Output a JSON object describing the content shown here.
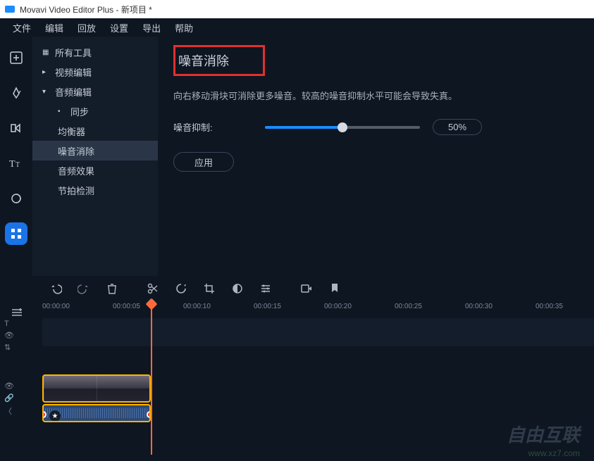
{
  "title": "Movavi Video Editor Plus - 新项目 *",
  "menu": [
    "文件",
    "编辑",
    "回放",
    "设置",
    "导出",
    "帮助"
  ],
  "sidebar": {
    "allTools": "所有工具",
    "videoEdit": "视频编辑",
    "audioEdit": "音频编辑",
    "sync": "同步",
    "equalizer": "均衡器",
    "noiseRemoval": "噪音消除",
    "audioFx": "音频效果",
    "beatDetect": "节拍检测"
  },
  "panel": {
    "title": "噪音消除",
    "desc": "向右移动滑块可消除更多噪音。较高的噪音抑制水平可能会导致失真。",
    "suppressLabel": "噪音抑制:",
    "value": "50%",
    "apply": "应用"
  },
  "timecodes": [
    "00:00:00",
    "00:00:05",
    "00:00:10",
    "00:00:15",
    "00:00:20",
    "00:00:25",
    "00:00:30",
    "00:00:35"
  ],
  "watermark": {
    "main": "自由互联",
    "sub": "www.xz7.com"
  }
}
